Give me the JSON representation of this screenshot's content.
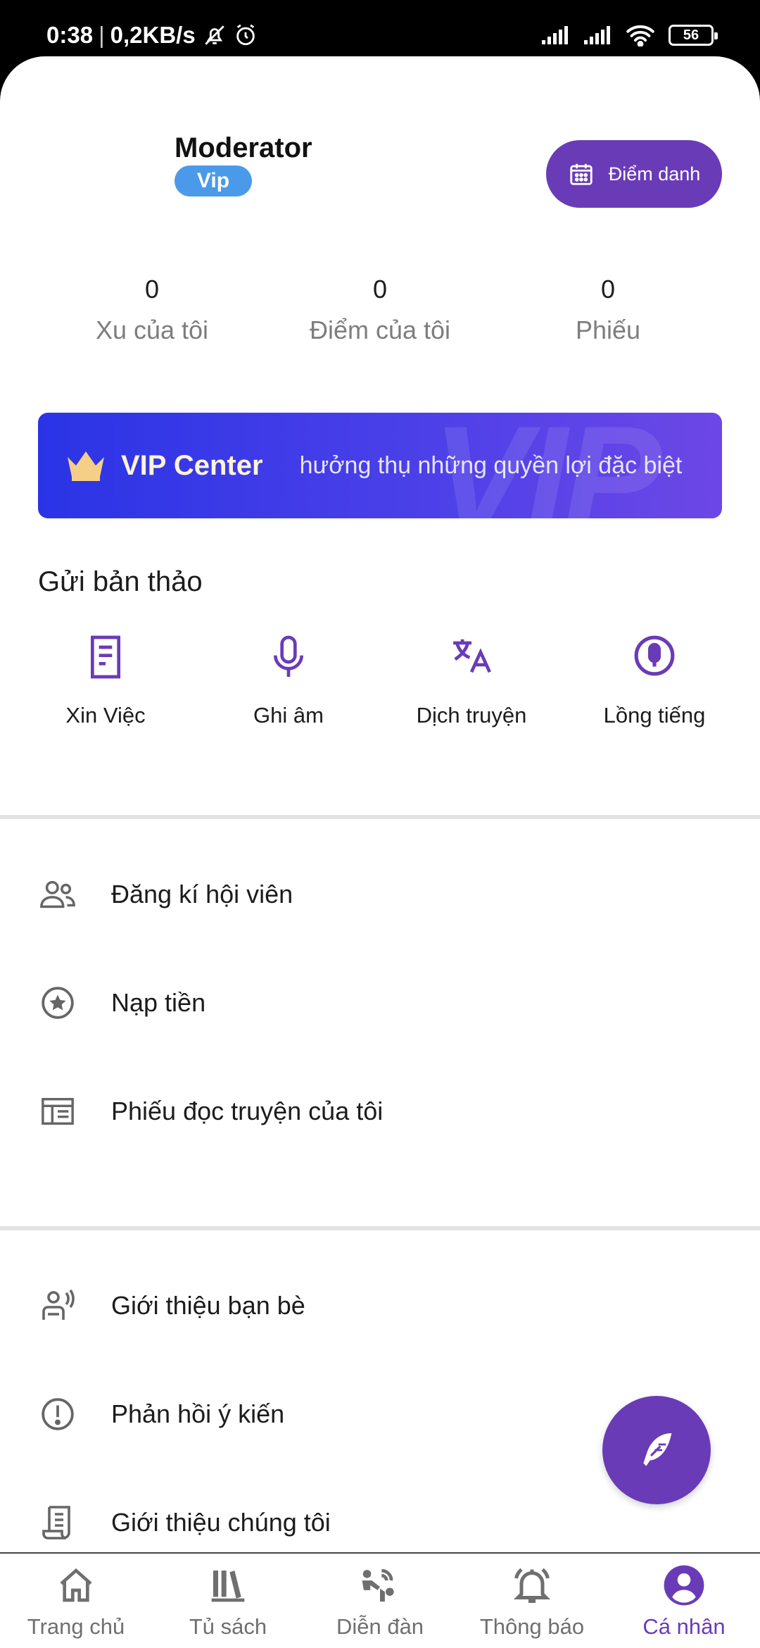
{
  "status_bar": {
    "time": "0:38",
    "speed": "0,2KB/s",
    "battery": "56",
    "icons": [
      "mute-icon",
      "alarm-icon",
      "signal-icon",
      "signal-icon",
      "wifi-icon",
      "battery-icon"
    ]
  },
  "profile": {
    "name": "Moderator",
    "badge": "Vip",
    "checkin_label": "Điểm danh"
  },
  "stats": [
    {
      "value": "0",
      "label": "Xu của tôi"
    },
    {
      "value": "0",
      "label": "Điểm của tôi"
    },
    {
      "value": "0",
      "label": "Phiếu"
    }
  ],
  "vip_banner": {
    "title": "VIP Center",
    "subtitle": "hưởng thụ những quyền lợi đặc biệt",
    "watermark": "VIP"
  },
  "submit_section": {
    "title": "Gửi bản thảo",
    "tools": [
      {
        "label": "Xin Việc",
        "icon": "document-icon"
      },
      {
        "label": "Ghi âm",
        "icon": "microphone-icon"
      },
      {
        "label": "Dịch truyện",
        "icon": "translate-icon"
      },
      {
        "label": "Lồng tiếng",
        "icon": "voice-circle-icon"
      }
    ]
  },
  "menu_group_1": [
    {
      "label": "Đăng kí hội viên",
      "icon": "users-icon"
    },
    {
      "label": "Nạp tiền",
      "icon": "star-circle-icon"
    },
    {
      "label": "Phiếu đọc truyện của tôi",
      "icon": "ticket-icon"
    }
  ],
  "menu_group_2": [
    {
      "label": "Giới thiệu bạn bè",
      "icon": "share-user-icon"
    },
    {
      "label": "Phản hồi ý kiến",
      "icon": "alert-circle-icon"
    },
    {
      "label": "Giới thiệu chúng tôi",
      "icon": "scroll-icon"
    }
  ],
  "bottom_nav": [
    {
      "label": "Trang chủ",
      "icon": "home-icon",
      "active": false
    },
    {
      "label": "Tủ sách",
      "icon": "bookshelf-icon",
      "active": false
    },
    {
      "label": "Diễn đàn",
      "icon": "forum-icon",
      "active": false
    },
    {
      "label": "Thông báo",
      "icon": "bell-icon",
      "active": false
    },
    {
      "label": "Cá nhân",
      "icon": "profile-icon",
      "active": true
    }
  ],
  "colors": {
    "accent": "#6a3bb7",
    "badge": "#4a9ae9",
    "banner_start": "#2a34e6",
    "banner_end": "#6d47e6",
    "muted_text": "#7d7d7d"
  }
}
